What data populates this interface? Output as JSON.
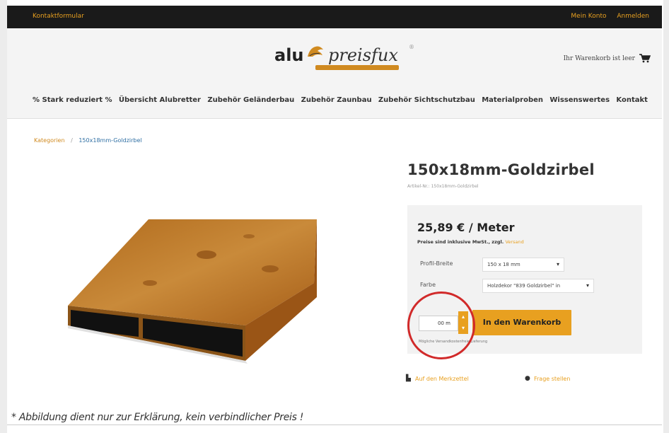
{
  "topbar": {
    "left_link": "Kontaktformular",
    "right_links": [
      "Mein Konto",
      "Anmelden"
    ]
  },
  "logo": {
    "alu": "alu",
    "preis": "preisfux",
    "reg": "®"
  },
  "cart": {
    "label": "Ihr Warenkorb ist leer",
    "icon": "cart-icon"
  },
  "nav": {
    "items": [
      "% Stark reduziert %",
      "Übersicht Alubretter",
      "Zubehör Geländerbau",
      "Zubehör Zaunbau",
      "Zubehör Sichtschutzbau",
      "Materialproben",
      "Wissenswertes",
      "Kontakt"
    ]
  },
  "breadcrumb": {
    "root": "Kategorien",
    "sep": "/",
    "current": "150x18mm-Goldzirbel"
  },
  "product": {
    "title": "150x18mm-Goldzirbel",
    "subtitle": "Artikel-Nr.: 150x18mm-Goldzirbel",
    "price": "25,89 € / Meter",
    "tax_text": "Preise sind inklusive MwSt., zzgl.",
    "shipping_link": "Versand",
    "options": [
      {
        "label": "Profil-Breite",
        "value": "150 x 18 mm"
      },
      {
        "label": "Farbe",
        "value": "Holzdekor \"839 Goldzirbel\" in"
      }
    ],
    "quantity": "00 m",
    "add_to_cart": "In den Warenkorb",
    "hint": "Mögliche Versandkostenfreie Lieferung",
    "links": {
      "wishlist": "Auf den Merkzettel",
      "question": "Frage stellen"
    }
  },
  "disclaimer": "* Abbildung dient nur zur Erklärung, kein verbindlicher Preis !",
  "colors": {
    "accent": "#e8a020",
    "topbar": "#1a1a1a",
    "highlight_circle": "#d12a2a"
  }
}
